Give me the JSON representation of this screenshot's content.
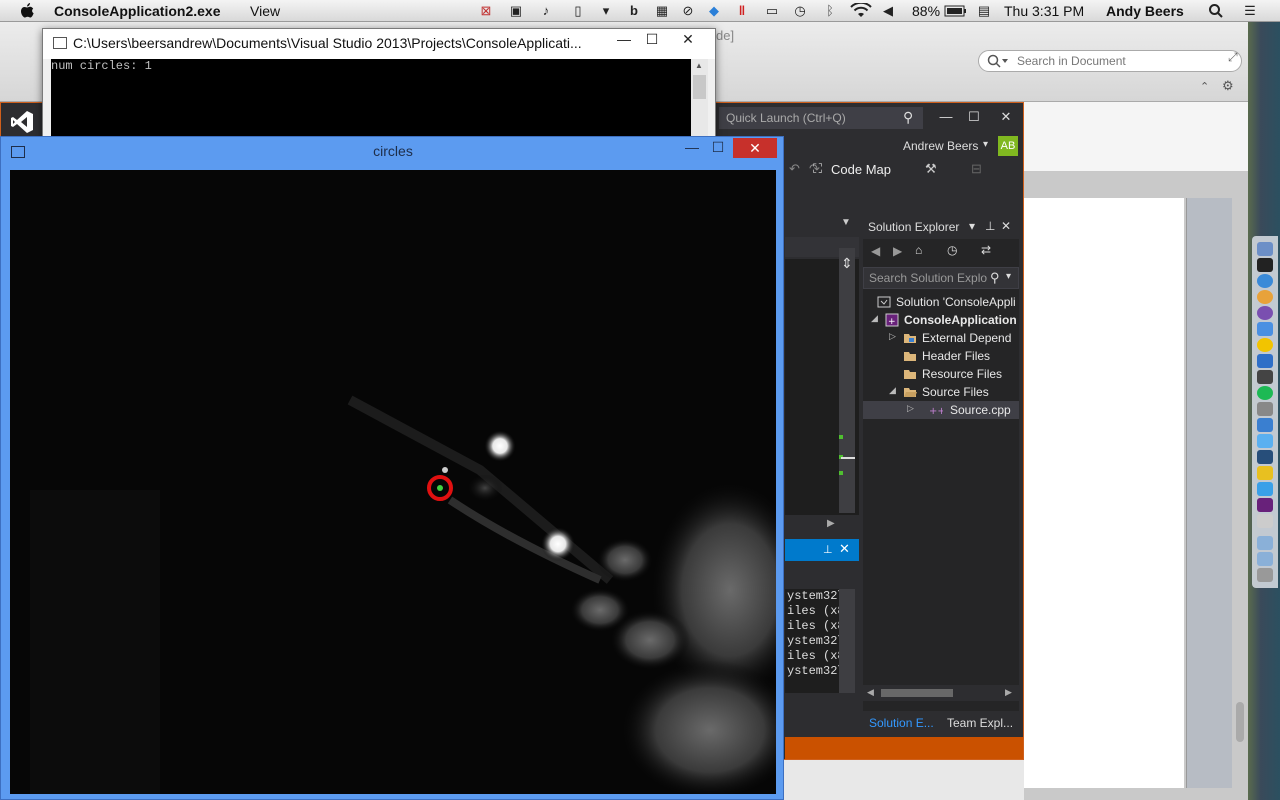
{
  "menubar": {
    "app_name": "ConsoleApplication2.exe",
    "menu_view": "View",
    "battery": "88%",
    "clock": "Thu 3:31 PM",
    "username": "Andy Beers"
  },
  "docapp": {
    "title_tail": "de]",
    "search_placeholder": "Search in Document"
  },
  "vs": {
    "quick_launch": "Quick Launch (Ctrl+Q)",
    "user_name": "Andrew Beers",
    "avatar_initials": "AB",
    "code_map": "Code Map",
    "output_lines": [
      "ystem32\\",
      "iles (x8",
      "iles (x8",
      "ystem32\\",
      "iles (x8",
      "ystem32\\"
    ],
    "solution_explorer": {
      "header": "Solution Explorer",
      "search_placeholder": "Search Solution Explo",
      "tree": [
        {
          "label": "Solution 'ConsoleAppli",
          "arrow": "",
          "indent": 0,
          "icon": "solution-icon",
          "bold": false,
          "selected": false
        },
        {
          "label": "ConsoleApplication",
          "arrow": "◢",
          "indent": 0,
          "icon": "cpp-project-icon",
          "bold": true,
          "selected": false
        },
        {
          "label": "External Depend",
          "arrow": "▷",
          "indent": 1,
          "icon": "folder-icon",
          "bold": false,
          "selected": false
        },
        {
          "label": "Header Files",
          "arrow": "",
          "indent": 1,
          "icon": "folder-icon",
          "bold": false,
          "selected": false
        },
        {
          "label": "Resource Files",
          "arrow": "",
          "indent": 1,
          "icon": "folder-icon",
          "bold": false,
          "selected": false
        },
        {
          "label": "Source Files",
          "arrow": "◢",
          "indent": 1,
          "icon": "folder-icon",
          "bold": false,
          "selected": false
        },
        {
          "label": "Source.cpp",
          "arrow": "▷",
          "indent": 2,
          "icon": "cpp-file-icon",
          "bold": false,
          "selected": true
        }
      ],
      "tab_solution": "Solution E...",
      "tab_team": "Team Expl..."
    }
  },
  "console": {
    "title": "C:\\Users\\beersandrew\\Documents\\Visual Studio 2013\\Projects\\ConsoleApplicati...",
    "output": "num circles: 1"
  },
  "circles_window": {
    "title": "circles"
  },
  "colors": {
    "vs_accent": "#cf5f1c",
    "vs_blue": "#007acc",
    "circle_marker": "#e01010",
    "center_marker": "#40d040"
  }
}
